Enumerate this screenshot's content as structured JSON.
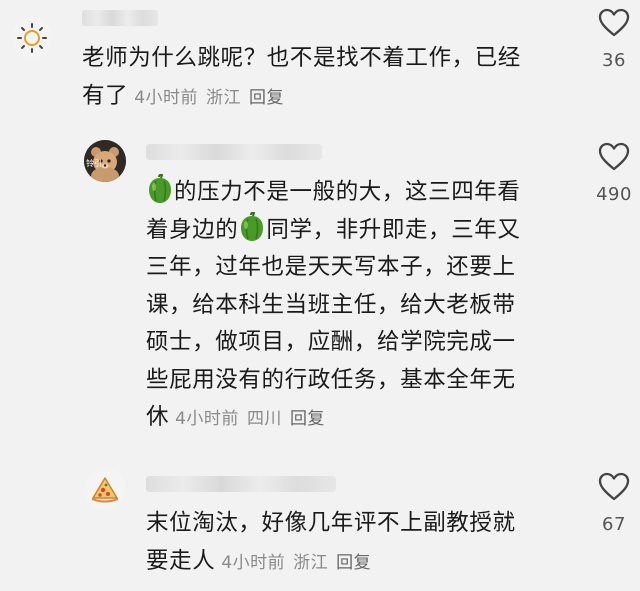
{
  "comments": [
    {
      "text": "老师为什么跳呢？也不是找不着工作，已经有了",
      "line1": "老师为什么跳呢？也不是找不着工作，已经",
      "line2": "有了",
      "time": "4小时前",
      "location": "浙江",
      "reply": "回复",
      "likes": "36"
    },
    {
      "lines": [
        "的压力不是一般的大，这三四年看",
        "着身边的",
        "同学，非升即走，三年又",
        "三年，过年也是天天写本子，还要上",
        "课，给本科生当班主任，给大老板带",
        "硕士，做项目，应酬，给学院完成一",
        "些屁用没有的行政任务，基本全年无",
        "休"
      ],
      "time": "4小时前",
      "location": "四川",
      "reply": "回复",
      "likes": "490",
      "avatar_text": "铃引"
    },
    {
      "line1": "末位淘汰，好像几年评不上副教授就",
      "line2": "要走人",
      "time": "4小时前",
      "location": "浙江",
      "reply": "回复",
      "likes": "67"
    }
  ],
  "icons": {
    "avatar1": "sun-icon",
    "avatar2": "teddy-bear-avatar",
    "avatar3": "pizza-icon",
    "like": "heart-outline-icon",
    "emoji": "green-pepper-emoji"
  },
  "colors": {
    "background": "#f2f2f2",
    "text": "#1a1a1a",
    "meta": "#8a8a8a",
    "pepper": "#4a9a2a"
  }
}
